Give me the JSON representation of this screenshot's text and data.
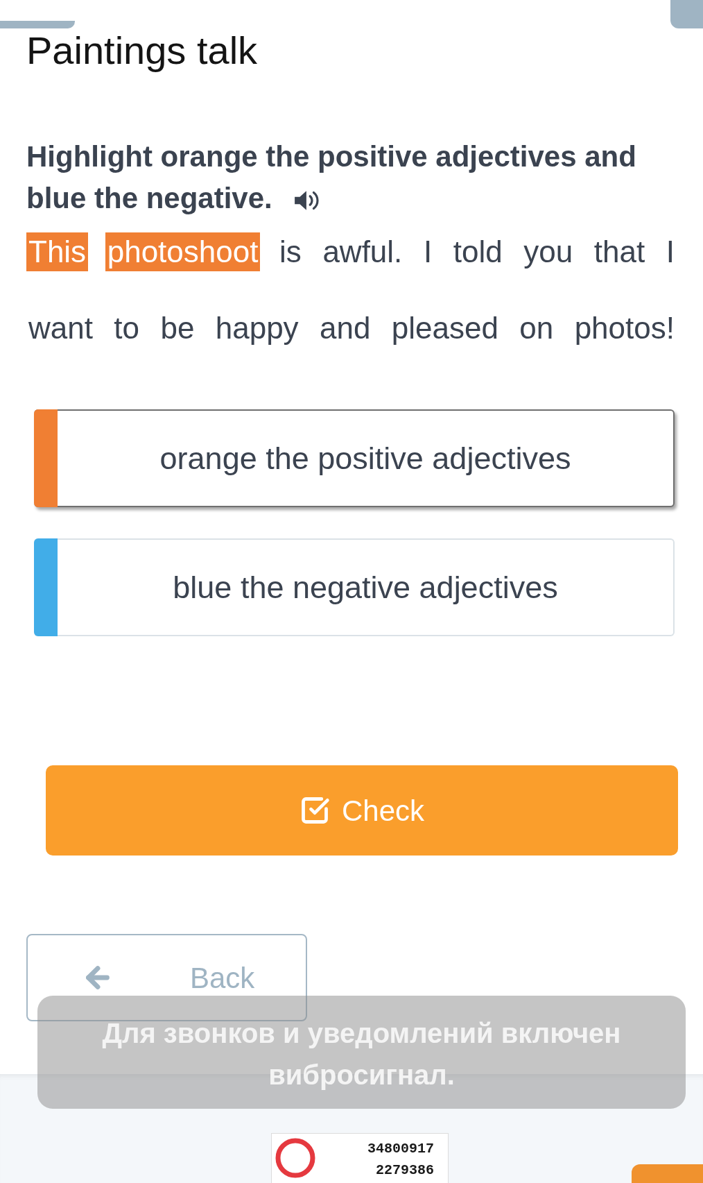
{
  "header": {
    "title": "Paintings talk"
  },
  "task": {
    "instruction": "Highlight orange the positive adjectives and blue the negative.",
    "sentence_lines": [
      [
        {
          "text": "This",
          "color": "#f07f33"
        },
        {
          "text": "photoshoot",
          "color": "#f07f33"
        },
        {
          "text": "is"
        },
        {
          "text": "awful."
        },
        {
          "text": "I"
        },
        {
          "text": "told"
        },
        {
          "text": "you"
        },
        {
          "text": "that"
        },
        {
          "text": "I"
        }
      ],
      [
        {
          "text": "want"
        },
        {
          "text": "to"
        },
        {
          "text": "be"
        },
        {
          "text": "happy"
        },
        {
          "text": "and"
        },
        {
          "text": "pleased"
        },
        {
          "text": "on"
        },
        {
          "text": "photos!"
        }
      ]
    ]
  },
  "options": [
    {
      "label": "orange the positive adjectives",
      "color": "#f07f33",
      "selected": true
    },
    {
      "label": "blue the negative adjectives",
      "color": "#41ade8",
      "selected": false
    }
  ],
  "check_button": {
    "label": "Check"
  },
  "back_button": {
    "label": "Back"
  },
  "toast": {
    "message": "Для звонков и уведомлений включен вибросигнал."
  },
  "footer": {
    "counter_lines": [
      "34800917",
      "2279386"
    ]
  }
}
